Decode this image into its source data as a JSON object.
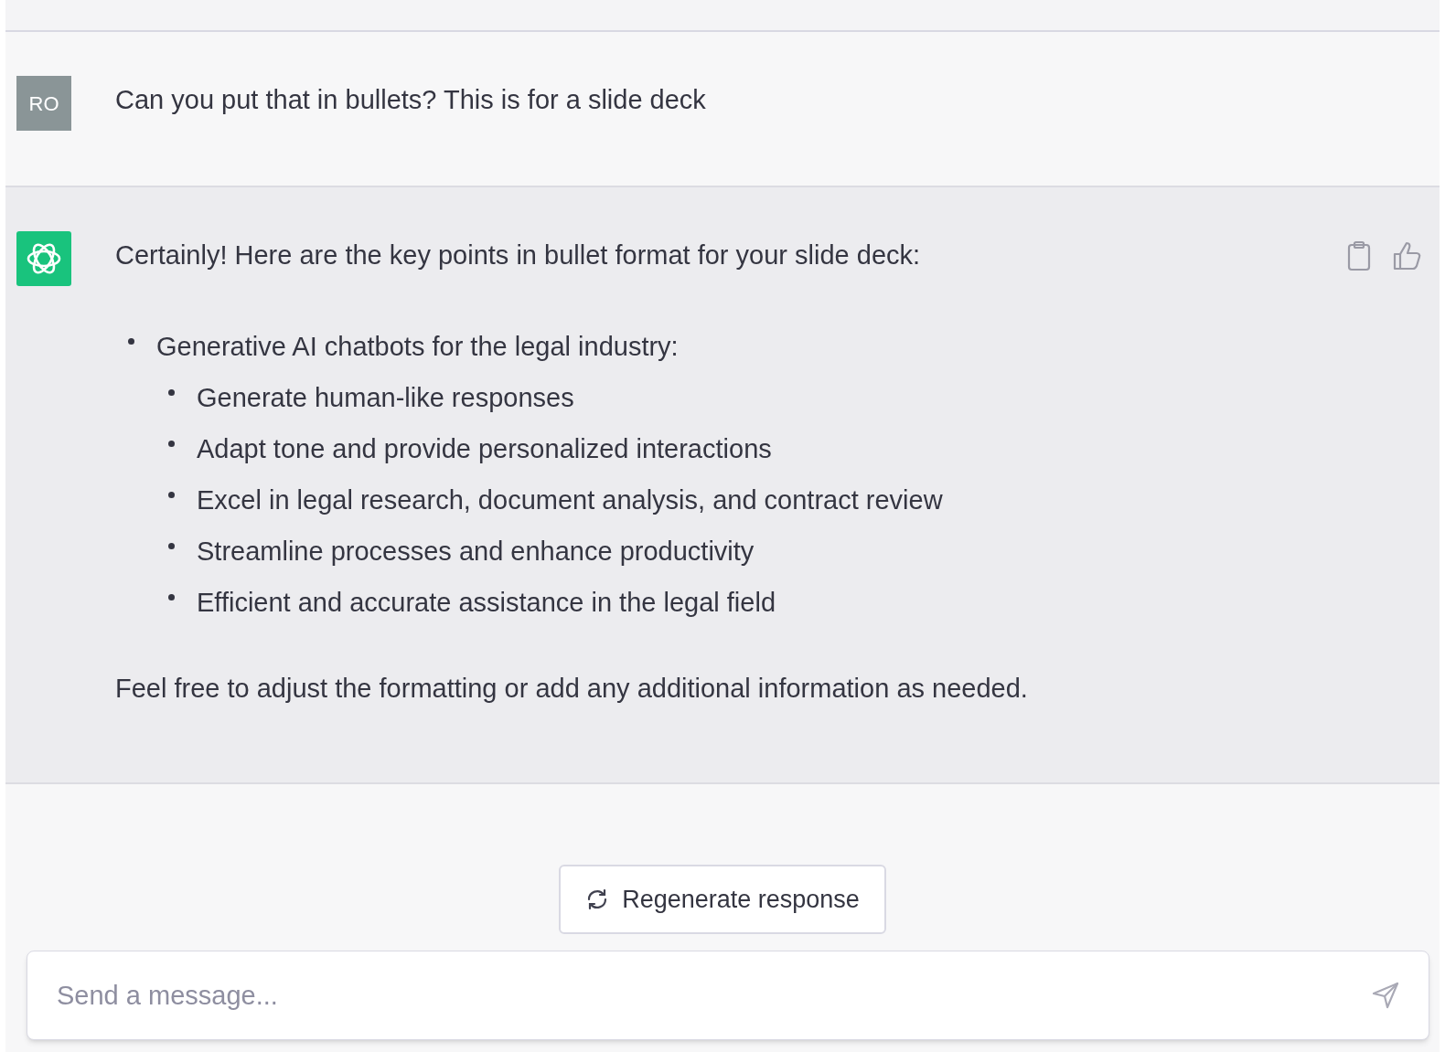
{
  "user_message": {
    "avatar": "RO",
    "text": "Can you put that in bullets? This is for a slide deck"
  },
  "assistant_message": {
    "intro": "Certainly! Here are the key points in bullet format for your slide deck:",
    "bullets": [
      {
        "text": "Generative AI chatbots for the legal industry:",
        "children": [
          {
            "text": "Generate human-like responses"
          },
          {
            "text": "Adapt tone and provide personalized interactions"
          },
          {
            "text": "Excel in legal research, document analysis, and contract review"
          },
          {
            "text": "Streamline processes and enhance productivity"
          },
          {
            "text": "Efficient and accurate assistance in the legal field"
          }
        ]
      }
    ],
    "outro": "Feel free to adjust the formatting or add any additional information as needed."
  },
  "regenerate_button": "Regenerate response",
  "composer": {
    "placeholder": "Send a message..."
  }
}
